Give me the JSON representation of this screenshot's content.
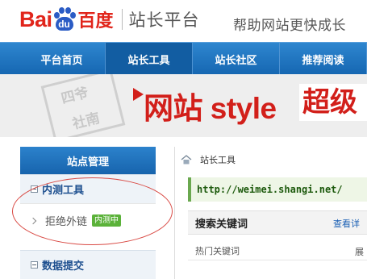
{
  "header": {
    "logo_latin": "Bai",
    "logo_paw_text": "du",
    "logo_chinese": "百度",
    "platform_name": "站长平台",
    "slogan": "帮助网站更快成长"
  },
  "nav": {
    "items": [
      {
        "label": "平台首页"
      },
      {
        "label": "站长工具"
      },
      {
        "label": "站长社区"
      },
      {
        "label": "推荐阅读"
      }
    ],
    "active_index": 1
  },
  "banner": {
    "stamp_line1": "四爷",
    "stamp_line2": "社南",
    "title": "网站 style",
    "title_suffix": "超级"
  },
  "sidebar": {
    "header": "站点管理",
    "group1": "内测工具",
    "sub_item": "拒绝外链",
    "sub_badge": "内测中",
    "group2": "数据提交"
  },
  "main": {
    "breadcrumb": "站长工具",
    "site_url": "http://weimei.shangi.net/",
    "keyword_title": "搜索关键词",
    "keyword_more": "查看详",
    "row_label": "热门关键词",
    "row_right": "展"
  },
  "colors": {
    "brand_red": "#e1251b",
    "brand_blue": "#2b5cc5",
    "nav_blue": "#1667b2",
    "annotation_red": "#d94a44",
    "badge_green": "#5bb23a"
  }
}
